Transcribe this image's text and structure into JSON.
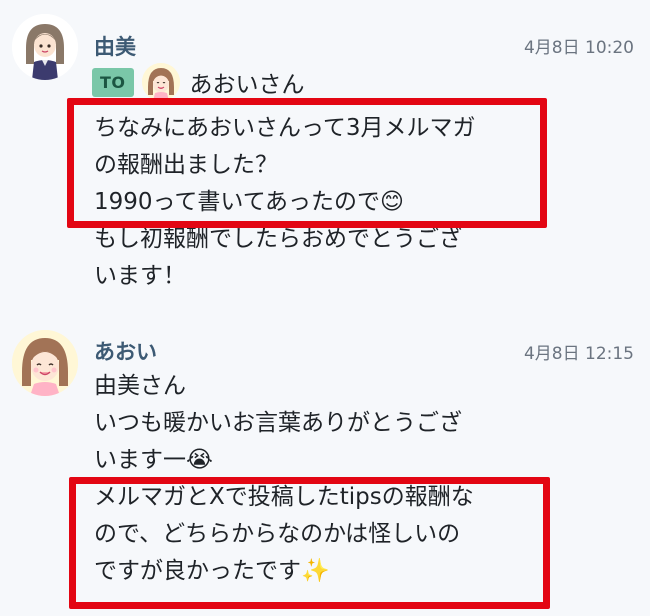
{
  "messages": [
    {
      "sender": "由美",
      "timestamp": "4月8日 10:20",
      "to": {
        "badge": "TO",
        "name": "あおいさん"
      },
      "lines": [
        "ちなみにあおいさんって3月メルマガ",
        "の報酬出ました？",
        "1990って書いてあったので😊",
        "もし初報酬でしたらおめでとうござ",
        "います！"
      ]
    },
    {
      "sender": "あおい",
      "timestamp": "4月8日 12:15",
      "lines": [
        "由美さん",
        "いつも暖かいお言葉ありがとうござ",
        "います一😭",
        "メルマガとXで投稿したtipsの報酬な",
        "ので、どちらからなのかは怪しいの",
        "ですが良かったです✨"
      ]
    }
  ],
  "colors": {
    "background": "#f6f8fb",
    "sender_name": "#3d5a74",
    "to_badge": "#7ac7a8",
    "highlight_box": "#e30613"
  },
  "icons": {
    "yumi_avatar": "girl-brown-hair-avatar-icon",
    "aoi_avatar": "smiling-girl-avatar-icon"
  }
}
